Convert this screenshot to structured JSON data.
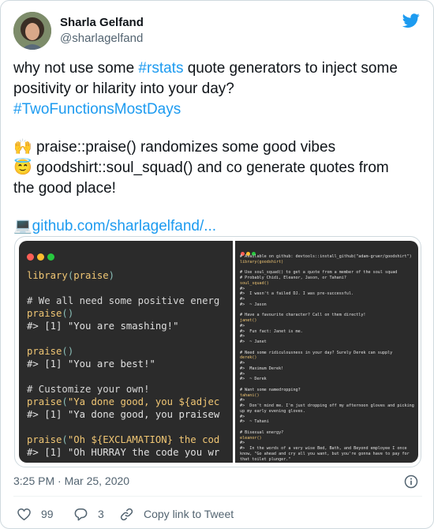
{
  "author": {
    "name": "Sharla Gelfand",
    "handle": "@sharlagelfand"
  },
  "tweet": {
    "line1": "why not use some ",
    "hashtag1": "#rstats",
    "line1_end": " quote generators to inject some",
    "line2": "positivity or hilarity into your day?",
    "hashtag2": "#TwoFunctionsMostDays",
    "praise_emoji": "🙌",
    "praise_text": " praise::praise() randomizes some good vibes",
    "angel_emoji": "😇",
    "angel_text": " goodshirt::soul_squad() and co generate quotes from",
    "angel_text2": "the good place!",
    "laptop_emoji": "💻",
    "url": "github.com/sharlagelfand/..."
  },
  "code_left": {
    "lines": [
      {
        "type": "call",
        "fn": "library",
        "arg": "praise"
      },
      {
        "type": "blank"
      },
      {
        "type": "comment",
        "text": "# We all need some positive energ"
      },
      {
        "type": "call",
        "fn": "praise",
        "arg": ""
      },
      {
        "type": "out",
        "text": "#> [1] \"You are smashing!\""
      },
      {
        "type": "blank"
      },
      {
        "type": "call",
        "fn": "praise",
        "arg": ""
      },
      {
        "type": "out",
        "text": "#> [1] \"You are best!\""
      },
      {
        "type": "blank"
      },
      {
        "type": "comment",
        "text": "# Customize your own!"
      },
      {
        "type": "callstr",
        "fn": "praise",
        "arg": "\"Ya done good, you ${adjec"
      },
      {
        "type": "out",
        "text": "#> [1] \"Ya done good, you praisew"
      },
      {
        "type": "blank"
      },
      {
        "type": "callstr",
        "fn": "praise",
        "arg": "\"Oh ${EXCLAMATION} the cod"
      },
      {
        "type": "out",
        "text": "#> [1] \"Oh HURRAY the code you wr"
      }
    ]
  },
  "code_right": {
    "lines": [
      "# Available on github: devtools::install_github(\"adam-gruer/goodshirt\")",
      "library(goodshirt)",
      "",
      "# Use soul_squad() to get a quote from a member of the soul squad",
      "# Probably Chidi, Eleanor, Jason, or Tahani?",
      "soul_squad()",
      "#>",
      "#>  I wasn't a failed DJ. I was pre-successful.",
      "#>",
      "#>  ~ Jason",
      "",
      "# Have a favourite character? Call on them directly!",
      "janet()",
      "#>",
      "#>  Fun fact: Janet is me.",
      "#>",
      "#>  ~ Janet",
      "",
      "# Need some ridiculousness in your day? Surely Derek can supply",
      "derek()",
      "#>",
      "#>  Maximum Derek!",
      "#>",
      "#>  ~ Derek",
      "",
      "# Want some namedropping?",
      "tahani()",
      "#>",
      "#>  Don't mind me. I'm just dropping off my afternoon gloves and picking",
      "up my early evening gloves.",
      "#>",
      "#>  ~ Tahani",
      "",
      "# Bisexual energy?",
      "eleanor()",
      "#>",
      "#>  In the words of a very wise Bed, Bath, and Beyond employee I once",
      "know, \"Go ahead and cry all you want, but you're gonna have to pay for",
      "that toilet plunger.\""
    ]
  },
  "meta": {
    "timestamp": "3:25 PM · Mar 25, 2020"
  },
  "actions": {
    "likes": "99",
    "replies": "3",
    "copy_link": "Copy link to Tweet"
  },
  "colors": {
    "accent": "#1d9bf0",
    "code_bg": "#2b2b2b",
    "dot_red": "#ff5f56",
    "dot_yellow": "#ffbd2e",
    "dot_green": "#27c93f"
  },
  "icons": {
    "brand": "twitter-bird-icon",
    "info": "info-icon",
    "like": "heart-icon",
    "reply": "reply-icon",
    "copy": "link-icon"
  }
}
